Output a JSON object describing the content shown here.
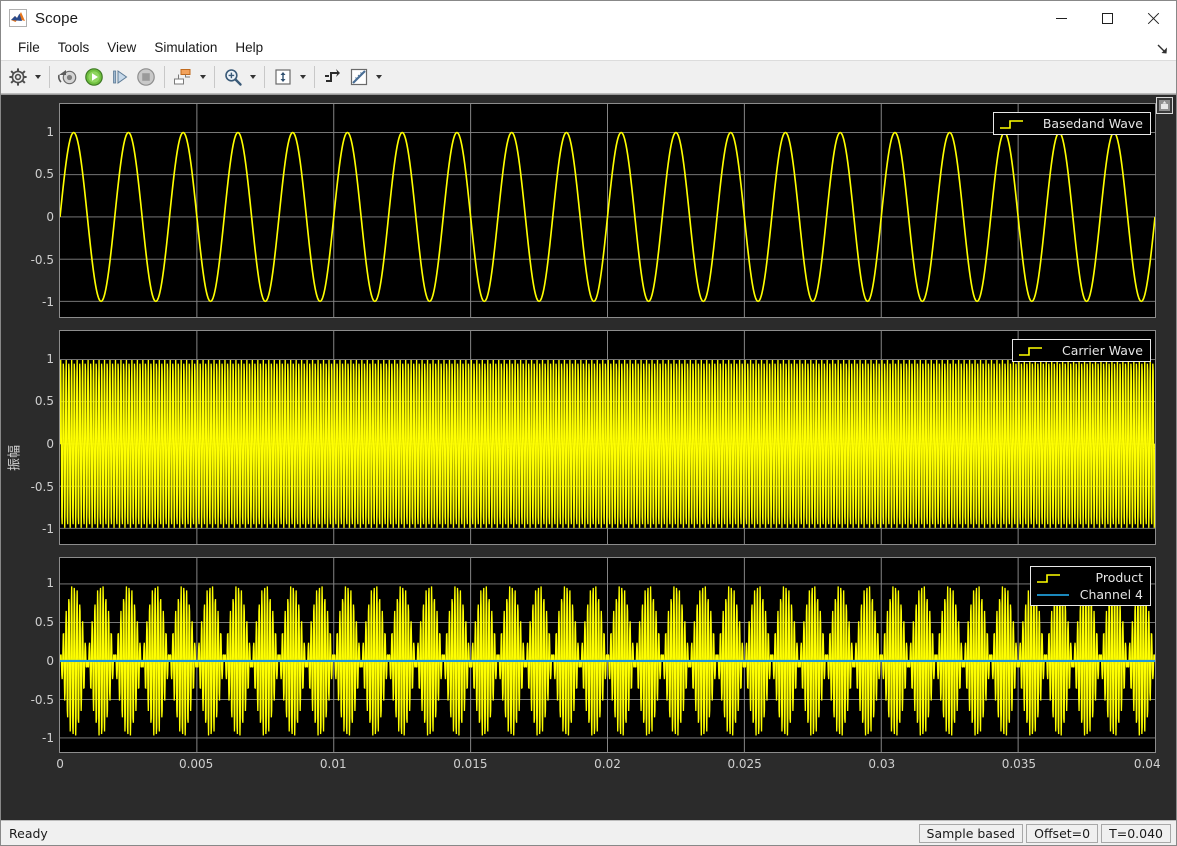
{
  "window": {
    "title": "Scope",
    "app_icon": "matlab-scope-icon",
    "minimize_label": "Minimize",
    "maximize_label": "Maximize",
    "close_label": "Close"
  },
  "menu": {
    "items": [
      {
        "label": "File"
      },
      {
        "label": "Tools"
      },
      {
        "label": "View"
      },
      {
        "label": "Simulation"
      },
      {
        "label": "Help"
      }
    ],
    "dock_icon": "undock-arrow-icon"
  },
  "toolbar": {
    "buttons": [
      {
        "name": "configuration-properties-button",
        "icon": "gear-icon",
        "caret": true
      },
      {
        "name": "separator-1",
        "icon": "separator",
        "caret": false
      },
      {
        "name": "run-back-to-start-button",
        "icon": "rewind-icon",
        "caret": false
      },
      {
        "name": "run-button",
        "icon": "play-icon",
        "caret": false
      },
      {
        "name": "step-forward-button",
        "icon": "step-forward-icon",
        "caret": false
      },
      {
        "name": "stop-button",
        "icon": "stop-icon",
        "caret": false
      },
      {
        "name": "separator-2",
        "icon": "separator",
        "caret": false
      },
      {
        "name": "layout-button",
        "icon": "layout-icon",
        "caret": true
      },
      {
        "name": "separator-3",
        "icon": "separator",
        "caret": false
      },
      {
        "name": "zoom-in-button",
        "icon": "zoom-in-icon",
        "caret": true
      },
      {
        "name": "separator-4",
        "icon": "separator",
        "caret": false
      },
      {
        "name": "scale-axes-limits-button",
        "icon": "autoscale-icon",
        "caret": true
      },
      {
        "name": "separator-5",
        "icon": "separator",
        "caret": false
      },
      {
        "name": "trigger-button",
        "icon": "trigger-icon",
        "caret": false
      },
      {
        "name": "measurements-button",
        "icon": "ruler-icon",
        "caret": true
      }
    ]
  },
  "scope": {
    "y_axis_label": "振幅",
    "maximize_axes_icon": "maximize-axes-icon",
    "colors": {
      "signal": "#ffff00",
      "channel4": "#1f9bd6",
      "background": "#000000",
      "grid": "#b4b4b4",
      "panel": "#2b2b2b",
      "axes_border": "#8c8c8c",
      "tick_text": "#cfcfcf"
    },
    "y_ticks": [
      "1",
      "0.5",
      "0",
      "-0.5",
      "-1"
    ],
    "x_ticks": [
      "0",
      "0.005",
      "0.01",
      "0.015",
      "0.02",
      "0.025",
      "0.03",
      "0.035",
      "0.04"
    ],
    "plots": [
      {
        "name": "baseband-wave-plot",
        "legend": [
          {
            "label": "Basedand Wave",
            "mark": "step",
            "color": "#ffff00"
          }
        ]
      },
      {
        "name": "carrier-wave-plot",
        "legend": [
          {
            "label": "Carrier Wave",
            "mark": "step",
            "color": "#ffff00"
          }
        ]
      },
      {
        "name": "product-plot",
        "legend": [
          {
            "label": "Product",
            "mark": "step",
            "color": "#ffff00"
          },
          {
            "label": "Channel 4",
            "mark": "line",
            "color": "#1f9bd6"
          }
        ]
      }
    ]
  },
  "chart_data": [
    {
      "type": "line",
      "title": "Basedand Wave",
      "xlabel": "",
      "ylabel": "振幅",
      "xlim": [
        0,
        0.04
      ],
      "ylim": [
        -1,
        1
      ],
      "xticks": [
        0,
        0.005,
        0.01,
        0.015,
        0.02,
        0.025,
        0.03,
        0.035,
        0.04
      ],
      "yticks": [
        -1,
        -0.5,
        0,
        0.5,
        1
      ],
      "grid": true,
      "legend_position": "top-right",
      "series": [
        {
          "name": "Basedand Wave",
          "color": "#ffff00",
          "waveform": "sine",
          "frequency_hz": 500,
          "amplitude": 1,
          "phase_rad": 0,
          "offset": 0,
          "cycles_visible": 20
        }
      ]
    },
    {
      "type": "line",
      "title": "Carrier Wave",
      "xlabel": "",
      "ylabel": "振幅",
      "xlim": [
        0,
        0.04
      ],
      "ylim": [
        -1,
        1
      ],
      "xticks": [
        0,
        0.005,
        0.01,
        0.015,
        0.02,
        0.025,
        0.03,
        0.035,
        0.04
      ],
      "yticks": [
        -1,
        -0.5,
        0,
        0.5,
        1
      ],
      "grid": true,
      "legend_position": "top-right",
      "series": [
        {
          "name": "Carrier Wave",
          "color": "#ffff00",
          "waveform": "sine",
          "frequency_hz": 10000,
          "amplitude": 1,
          "phase_rad": 0,
          "offset": 0,
          "cycles_visible": 400
        }
      ]
    },
    {
      "type": "line",
      "title": "Product",
      "xlabel": "",
      "ylabel": "振幅",
      "xlim": [
        0,
        0.04
      ],
      "ylim": [
        -1,
        1
      ],
      "xticks": [
        0,
        0.005,
        0.01,
        0.015,
        0.02,
        0.025,
        0.03,
        0.035,
        0.04
      ],
      "yticks": [
        -1,
        -0.5,
        0,
        0.5,
        1
      ],
      "grid": true,
      "legend_position": "top-right",
      "series": [
        {
          "name": "Product",
          "color": "#ffff00",
          "waveform": "amplitude-modulated",
          "carrier_hz": 10000,
          "modulation_hz": 500,
          "amplitude": 1,
          "offset": 0
        },
        {
          "name": "Channel 4",
          "color": "#1f9bd6",
          "waveform": "constant",
          "value": 0
        }
      ]
    }
  ],
  "statusbar": {
    "ready_text": "Ready",
    "sample_mode": "Sample based",
    "offset": "Offset=0",
    "time": "T=0.040"
  }
}
